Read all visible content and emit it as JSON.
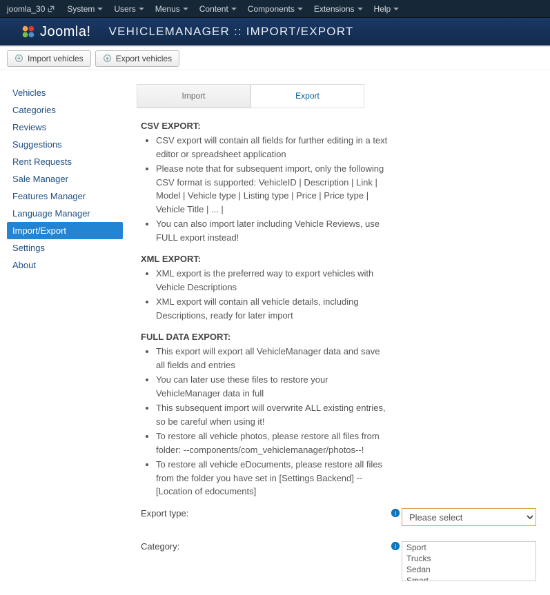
{
  "topbar": {
    "site": "joomla_30",
    "menu": [
      "System",
      "Users",
      "Menus",
      "Content",
      "Components",
      "Extensions",
      "Help"
    ]
  },
  "header": {
    "logo": "Joomla!",
    "page_title": "VEHICLEMANAGER :: IMPORT/EXPORT"
  },
  "toolbar": {
    "import": "Import vehicles",
    "export": "Export vehicles"
  },
  "sidebar": {
    "items": [
      {
        "label": "Vehicles"
      },
      {
        "label": "Categories"
      },
      {
        "label": "Reviews"
      },
      {
        "label": "Suggestions"
      },
      {
        "label": "Rent Requests"
      },
      {
        "label": "Sale Manager"
      },
      {
        "label": "Features Manager"
      },
      {
        "label": "Language Manager"
      },
      {
        "label": "Import/Export"
      },
      {
        "label": "Settings"
      },
      {
        "label": "About"
      }
    ],
    "active_index": 8
  },
  "tabs": {
    "import": "Import",
    "export": "Export"
  },
  "content": {
    "csv": {
      "title": "CSV EXPORT:",
      "items": [
        "CSV export will contain all fields for further editing in a text editor or spreadsheet application",
        "Please note that for subsequent import, only the following CSV format is supported:  VehicleID | Description | Link | Model | Vehicle type | Listing type | Price | Price type | Vehicle Title | ... |",
        "You can also import later including Vehicle Reviews, use FULL export instead!"
      ]
    },
    "xml": {
      "title": "XML EXPORT:",
      "items": [
        "XML export is the preferred way to export vehicles with Vehicle Descriptions",
        "XML export will contain all vehicle details, including Descriptions, ready for later import"
      ]
    },
    "full": {
      "title": "FULL DATA EXPORT:",
      "items": [
        "This export will export all VehicleManager data and save all fields and entries",
        "You can later use these files to restore your VehicleManager data in full",
        "This subsequent import will overwrite ALL existing entries, so be careful when using it!",
        "To restore all vehicle photos, please restore all files from folder: --components/com_vehiclemanager/photos--!",
        "To restore all vehicle eDocuments, please restore all files from the folder you have set in [Settings Backend] -- [Location of edocuments]"
      ]
    }
  },
  "form": {
    "export_type_label": "Export type:",
    "export_type_placeholder": "Please select",
    "category_label": "Category:",
    "category_options": [
      "Sport",
      "Trucks",
      "Sedan",
      "Smart"
    ]
  }
}
